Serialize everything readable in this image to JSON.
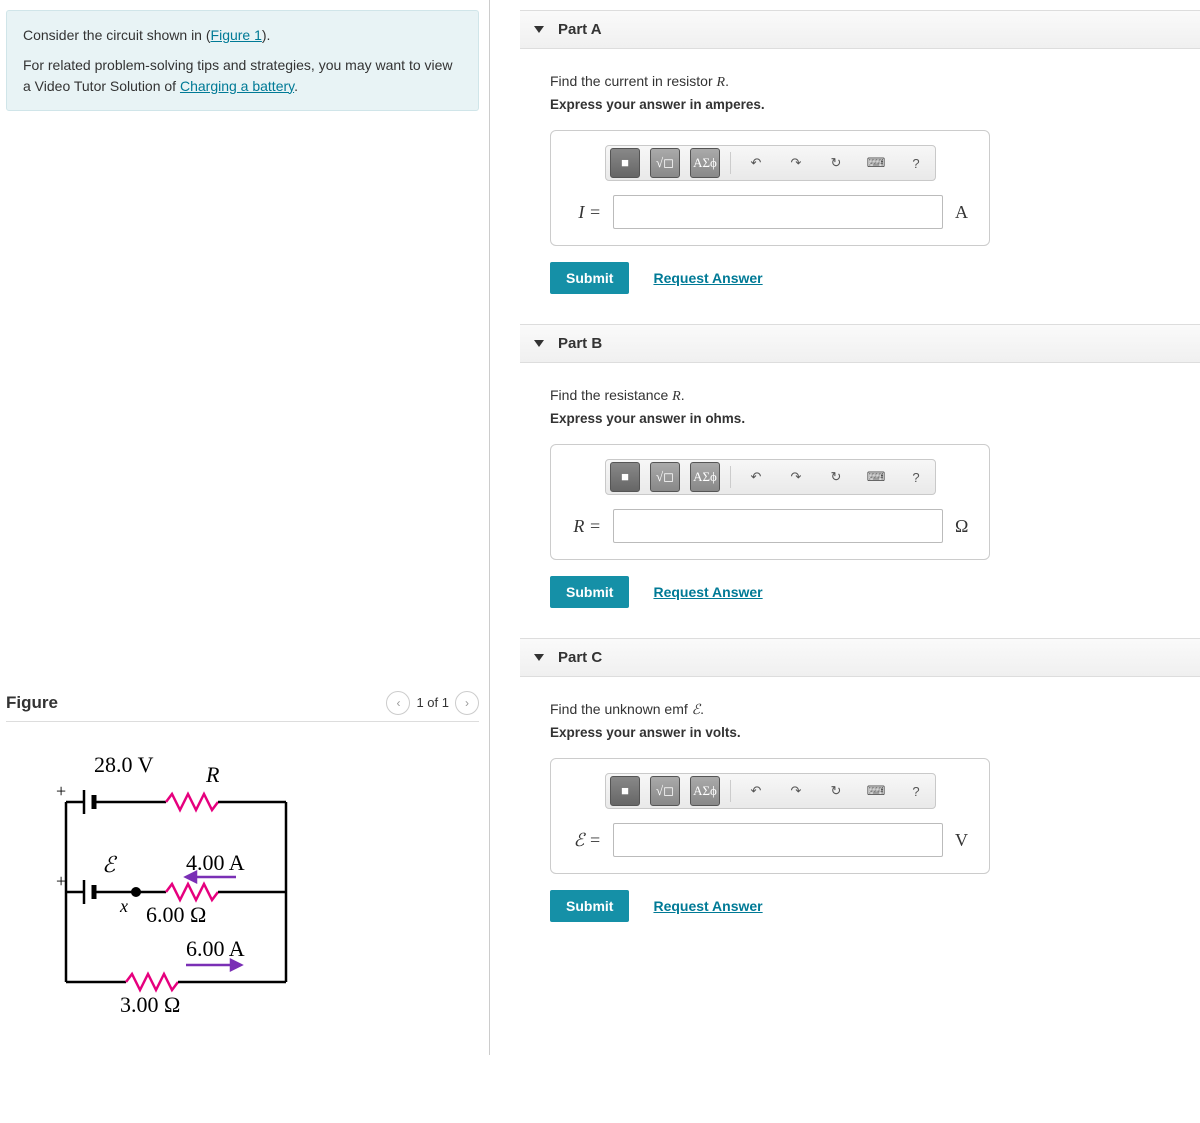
{
  "intro": {
    "line1_pre": "Consider the circuit shown in (",
    "figure_link": "Figure 1",
    "line1_post": ").",
    "line2_pre": "For related problem-solving tips and strategies, you may want to view a Video Tutor Solution of ",
    "video_link": "Charging a battery",
    "line2_post": "."
  },
  "figure": {
    "title": "Figure",
    "count": "1 of 1",
    "labels": {
      "voltage": "28.0 V",
      "R": "R",
      "emf": "ℰ",
      "I_mid": "4.00 A",
      "R_mid": "6.00 Ω",
      "I_bot": "6.00 A",
      "R_bot": "3.00 Ω",
      "node_x": "x",
      "plus1": "+",
      "plus2": "+"
    }
  },
  "toolbar": {
    "templates": "■",
    "radical": "√◻",
    "greek": "ΑΣϕ",
    "undo": "↶",
    "redo": "↷",
    "reset": "↻",
    "keyboard": "⌨",
    "help": "?"
  },
  "common": {
    "submit": "Submit",
    "request": "Request Answer"
  },
  "parts": {
    "A": {
      "title": "Part A",
      "prompt_pre": "Find the current in resistor ",
      "prompt_var": "R",
      "prompt_post": ".",
      "instr": "Express your answer in amperes.",
      "var": "I",
      "eq": " =",
      "unit": "A"
    },
    "B": {
      "title": "Part B",
      "prompt_pre": "Find the resistance ",
      "prompt_var": "R",
      "prompt_post": ".",
      "instr": "Express your answer in ohms.",
      "var": "R",
      "eq": " =",
      "unit": "Ω"
    },
    "C": {
      "title": "Part C",
      "prompt_pre": "Find the unknown emf ",
      "prompt_var": "ℰ",
      "prompt_post": ".",
      "instr": "Express your answer in volts.",
      "var": "ℰ",
      "eq": " =",
      "unit": "V"
    }
  }
}
